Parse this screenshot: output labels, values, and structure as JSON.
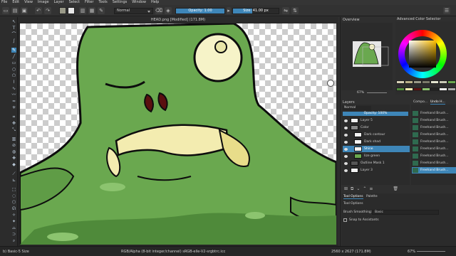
{
  "menu": [
    "File",
    "Edit",
    "View",
    "Image",
    "Layer",
    "Select",
    "Filter",
    "Tools",
    "Settings",
    "Window",
    "Help"
  ],
  "toolbar": {
    "blend_mode": "Normal",
    "opacity_label": "Opacity: 1.00",
    "opacity_fraction": 1.0,
    "size_label": "Size: 41.00 px",
    "size_fraction": 0.42
  },
  "document": {
    "title": "HEAD.png [Modified] (171.8M)"
  },
  "dockers": {
    "overview_title": "Overview",
    "color_title": "Advanced Color Selector",
    "layers_title": "Layers",
    "tabs_right": [
      "Compo...",
      "Undo H..."
    ],
    "zoom_value": "67%",
    "layer_blend": "Normal",
    "layer_opacity_label": "Opacity: 100%",
    "layers": [
      {
        "name": "Layer 5",
        "selected": false
      },
      {
        "name": "Color",
        "selected": false
      },
      {
        "name": "Dark contour",
        "selected": false
      },
      {
        "name": "Dark shad",
        "selected": false
      },
      {
        "name": "Shine",
        "selected": true
      },
      {
        "name": "lize green",
        "selected": false
      },
      {
        "name": "Outline Mask 1",
        "selected": false
      },
      {
        "name": "Layer 3",
        "selected": false
      }
    ],
    "undo_history": [
      {
        "name": "Freehand Brush...",
        "selected": false
      },
      {
        "name": "Freehand Brush...",
        "selected": false
      },
      {
        "name": "Freehand Brush...",
        "selected": false
      },
      {
        "name": "Freehand Brush...",
        "selected": false
      },
      {
        "name": "Freehand Brush...",
        "selected": false
      },
      {
        "name": "Freehand Brush...",
        "selected": false
      },
      {
        "name": "Freehand Brush...",
        "selected": false
      },
      {
        "name": "Freehand Brush...",
        "selected": false
      },
      {
        "name": "Freehand Brush...",
        "selected": true
      }
    ],
    "tool_options_tabs": [
      "Tool Options",
      "Palette"
    ],
    "tool_options_title": "Tool Options",
    "brush_smoothing_label": "Brush Smoothing:",
    "brush_smoothing_value": "Basic",
    "snap_label": "Snap to Assistants"
  },
  "status": {
    "left": "b) Basic-5 Size",
    "center": "RGB/Alpha (8-bit integer/channel) sRGB-elle-V2-srgbtrc.icc",
    "right": "2560 x 2627 (171.8M)",
    "zoom": "67%"
  },
  "colors": {
    "accent": "#3e86b8",
    "slime": "#6aa84f",
    "slime_dark": "#4f8a3a",
    "teeth": "#f3ecb0",
    "outline": "#0d0d0d"
  }
}
